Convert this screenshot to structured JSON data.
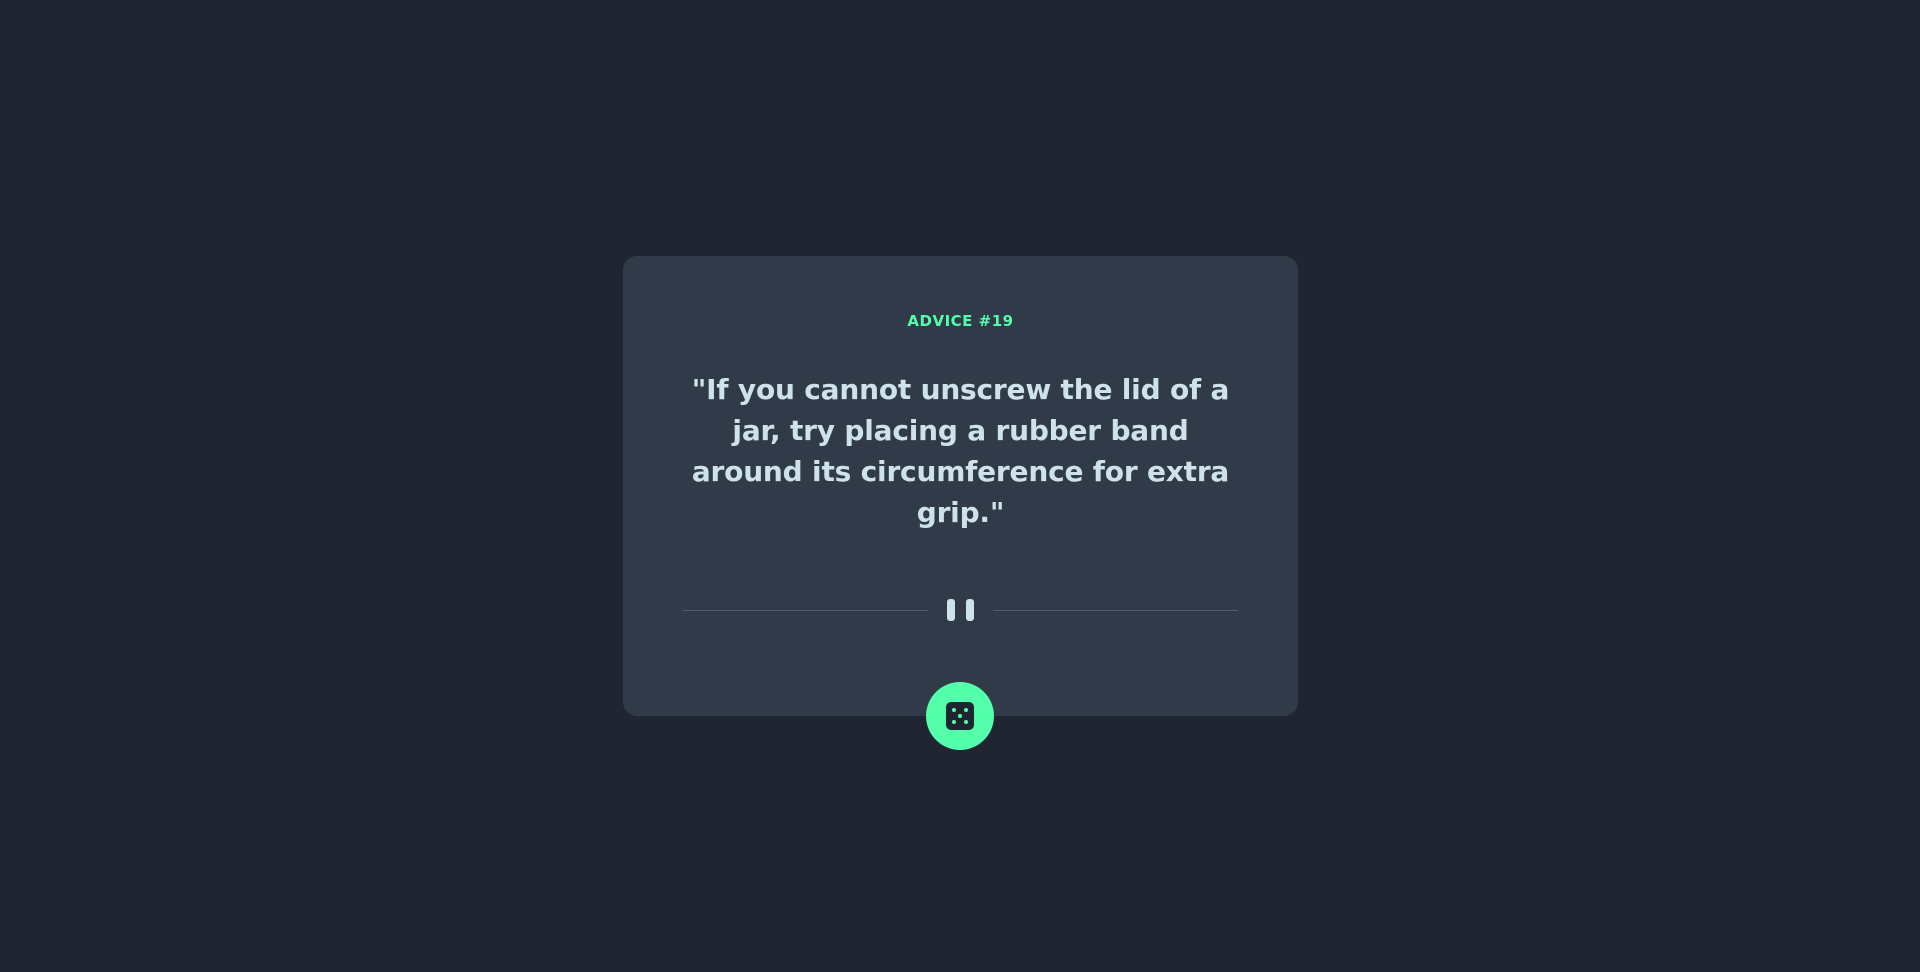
{
  "advice": {
    "id_label": "ADVICE #19",
    "text": "\"If you cannot unscrew the lid of a jar, try placing a rubber band around its circumference for extra grip.\""
  },
  "icons": {
    "divider": "pause-icon",
    "button": "dice-icon"
  },
  "colors": {
    "background": "#1f2632",
    "card": "#313a48",
    "accent": "#53ffaa",
    "text": "#cee3e9",
    "divider": "#4f5d74"
  }
}
